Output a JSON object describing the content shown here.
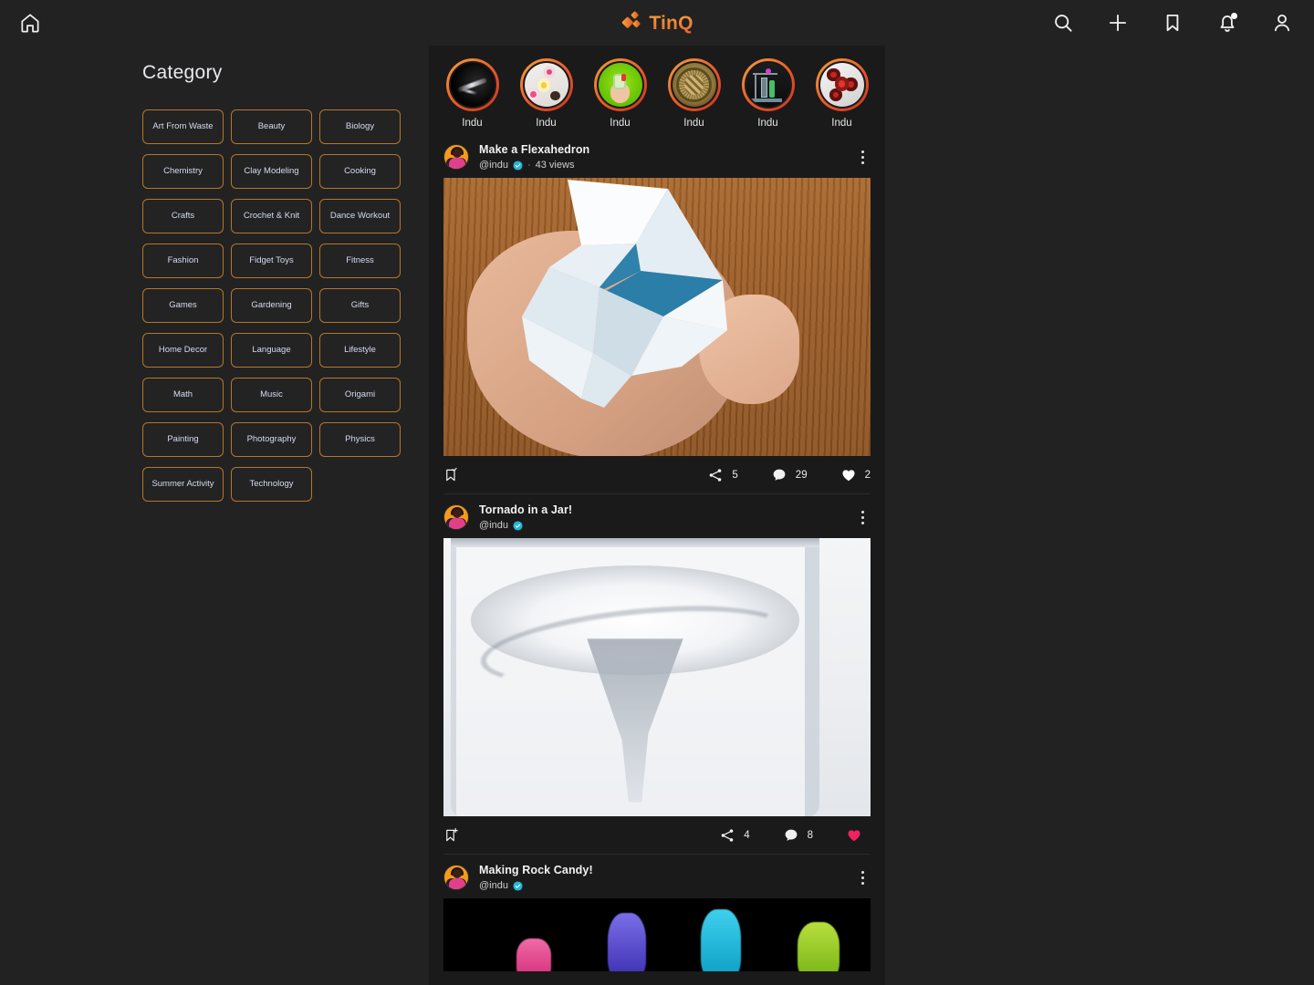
{
  "brand": {
    "name": "TinQ",
    "accent": "#e8642a"
  },
  "topbar": {
    "home_label": "home-icon",
    "icons": [
      {
        "name": "search-icon",
        "label": "Search"
      },
      {
        "name": "add-icon",
        "label": "Create"
      },
      {
        "name": "bookmark-icon",
        "label": "Saved"
      },
      {
        "name": "notifications-icon",
        "label": "Notifications"
      },
      {
        "name": "profile-icon",
        "label": "Profile"
      }
    ]
  },
  "category": {
    "title": "Category",
    "items": [
      "Art From Waste",
      "Beauty",
      "Biology",
      "Chemistry",
      "Clay Modeling",
      "Cooking",
      "Crafts",
      "Crochet & Knit",
      "Dance Workout",
      "Fashion",
      "Fidget Toys",
      "Fitness",
      "Games",
      "Gardening",
      "Gifts",
      "Home Decor",
      "Language",
      "Lifestyle",
      "Math",
      "Music",
      "Origami",
      "Painting",
      "Photography",
      "Physics",
      "Summer Activity",
      "Technology"
    ],
    "border_color": "#b5762b",
    "text_color": "#d6dcf0"
  },
  "stories": [
    {
      "label": "Indu",
      "thumb": "black-streaks"
    },
    {
      "label": "Indu",
      "thumb": "donuts"
    },
    {
      "label": "Indu",
      "thumb": "green-hand-battery"
    },
    {
      "label": "Indu",
      "thumb": "gold-coin"
    },
    {
      "label": "Indu",
      "thumb": "lab-apparatus"
    },
    {
      "label": "Indu",
      "thumb": "fidget-spinner"
    }
  ],
  "feed": [
    {
      "title": "Make a Flexahedron",
      "handle": "@indu",
      "verified": true,
      "views": "43 views",
      "separator": "·",
      "media": "hand-holding-paper-flexahedron",
      "share_count": "5",
      "comment_count": "29",
      "like_count": "2",
      "liked": false,
      "bookmark": "bookmark-check"
    },
    {
      "title": "Tornado in a Jar!",
      "handle": "@indu",
      "verified": true,
      "views": "",
      "separator": "",
      "media": "water-vortex-in-glass",
      "share_count": "4",
      "comment_count": "8",
      "like_count": "",
      "liked": true,
      "bookmark": "bookmark-add"
    },
    {
      "title": "Making Rock Candy!",
      "handle": "@indu",
      "verified": true,
      "views": "",
      "separator": "",
      "media": "colored-rock-candy-on-black",
      "share_count": "",
      "comment_count": "",
      "like_count": "",
      "liked": false,
      "bookmark": ""
    }
  ],
  "colors": {
    "page_bg": "#222222",
    "feed_bg": "#1a1a1a",
    "accent_orange": "#e8642a",
    "verified_blue": "#22b6d6",
    "like_pink": "#f1225f",
    "category_border": "#b5762b"
  }
}
